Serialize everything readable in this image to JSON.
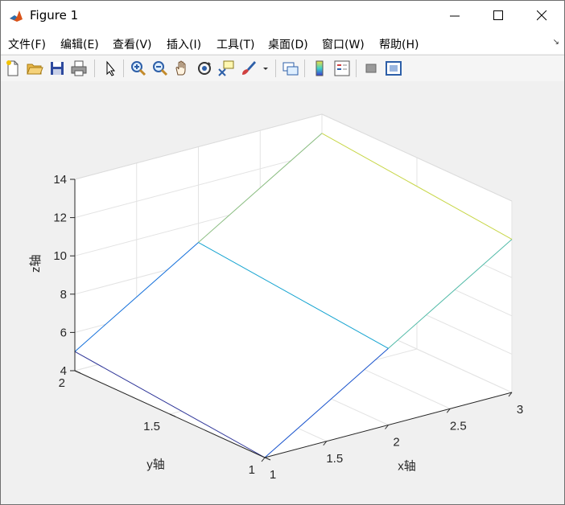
{
  "window": {
    "title": "Figure 1",
    "controls": [
      "minimize",
      "maximize",
      "close"
    ]
  },
  "menu": {
    "items": [
      "文件(F)",
      "编辑(E)",
      "查看(V)",
      "插入(I)",
      "工具(T)",
      "桌面(D)",
      "窗口(W)",
      "帮助(H)"
    ]
  },
  "toolbar": {
    "icons": [
      "new-figure-icon",
      "open-file-icon",
      "save-icon",
      "print-icon",
      "pointer-icon",
      "zoom-in-icon",
      "zoom-out-icon",
      "pan-hand-icon",
      "rotate-3d-icon",
      "data-cursor-icon",
      "brush-icon",
      "link-plot-icon",
      "colorbar-icon",
      "legend-icon",
      "hide-plot-tools-icon",
      "show-plot-tools-icon"
    ]
  },
  "chart_data": {
    "type": "surface",
    "title": "",
    "xlabel": "x轴",
    "ylabel": "y轴",
    "zlabel": "z轴",
    "x": [
      1,
      2,
      3
    ],
    "y": [
      1,
      2
    ],
    "z": [
      [
        4,
        8,
        12
      ],
      [
        5,
        9,
        13
      ]
    ],
    "xlim": [
      1,
      3
    ],
    "ylim": [
      1,
      2
    ],
    "zlim": [
      4,
      14
    ],
    "xticks": [
      "1",
      "1.5",
      "2",
      "2.5",
      "3"
    ],
    "yticks": [
      "1",
      "1.5",
      "2"
    ],
    "zticks": [
      "4",
      "6",
      "8",
      "10",
      "12",
      "14"
    ],
    "grid": true,
    "view": "3d-default"
  }
}
